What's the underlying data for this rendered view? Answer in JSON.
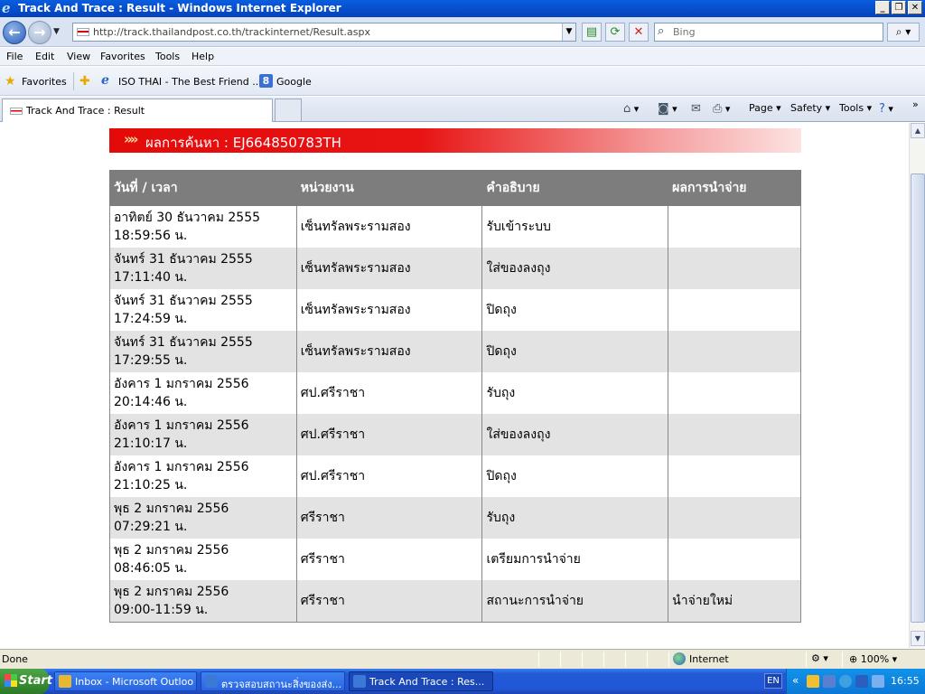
{
  "window": {
    "title": "Track And Trace : Result - Windows Internet Explorer"
  },
  "address": {
    "url": "http://track.thailandpost.co.th/trackinternet/Result.aspx"
  },
  "search": {
    "placeholder": "Bing"
  },
  "menu": [
    "File",
    "Edit",
    "View",
    "Favorites",
    "Tools",
    "Help"
  ],
  "favorites": {
    "label": "Favorites",
    "items": [
      "ISO THAI - The Best Friend ...",
      "Google"
    ]
  },
  "tab": {
    "label": "Track And Trace : Result"
  },
  "commands": {
    "page": "Page",
    "safety": "Safety",
    "tools": "Tools"
  },
  "result": {
    "label": "ผลการค้นหา : EJ664850783TH"
  },
  "table": {
    "headers": [
      "วันที่ / เวลา",
      "หน่วยงาน",
      "คำอธิบาย",
      "ผลการนำจ่าย"
    ],
    "rows": [
      {
        "date": "อาทิตย์ 30 ธันวาคม 2555",
        "time": "18:59:56 น.",
        "office": "เซ็นทรัลพระรามสอง",
        "desc": "รับเข้าระบบ",
        "result": ""
      },
      {
        "date": "จันทร์ 31 ธันวาคม 2555",
        "time": "17:11:40 น.",
        "office": "เซ็นทรัลพระรามสอง",
        "desc": "ใส่ของลงถุง",
        "result": ""
      },
      {
        "date": "จันทร์ 31 ธันวาคม 2555",
        "time": "17:24:59 น.",
        "office": "เซ็นทรัลพระรามสอง",
        "desc": "ปิดถุง",
        "result": ""
      },
      {
        "date": "จันทร์ 31 ธันวาคม 2555",
        "time": "17:29:55 น.",
        "office": "เซ็นทรัลพระรามสอง",
        "desc": "ปิดถุง",
        "result": ""
      },
      {
        "date": "อังคาร 1 มกราคม 2556",
        "time": "20:14:46 น.",
        "office": "ศป.ศรีราชา",
        "desc": "รับถุง",
        "result": ""
      },
      {
        "date": "อังคาร 1 มกราคม 2556",
        "time": "21:10:17 น.",
        "office": "ศป.ศรีราชา",
        "desc": "ใส่ของลงถุง",
        "result": ""
      },
      {
        "date": "อังคาร 1 มกราคม 2556",
        "time": "21:10:25 น.",
        "office": "ศป.ศรีราชา",
        "desc": "ปิดถุง",
        "result": ""
      },
      {
        "date": "พุธ 2 มกราคม 2556",
        "time": "07:29:21 น.",
        "office": "ศรีราชา",
        "desc": "รับถุง",
        "result": ""
      },
      {
        "date": "พุธ 2 มกราคม 2556",
        "time": "08:46:05 น.",
        "office": "ศรีราชา",
        "desc": "เตรียมการนำจ่าย",
        "result": ""
      },
      {
        "date": "พุธ 2 มกราคม 2556",
        "time": "09:00-11:59 น.",
        "office": "ศรีราชา",
        "desc": "สถานะการนำจ่าย",
        "result": "นำจ่ายใหม่"
      }
    ]
  },
  "status": {
    "text": "Done",
    "zone": "Internet",
    "zoom": "100%"
  },
  "taskbar": {
    "start": "Start",
    "items": [
      "Inbox - Microsoft Outlook",
      "ตรวจสอบสถานะสิ่งของส่ง...",
      "Track And Trace : Res..."
    ],
    "lang": "EN",
    "clock": "16:55"
  },
  "colors": {
    "result_bar": "#e40a0a",
    "header_bg": "#7d7d7d",
    "alt_row": "#e3e3e3",
    "titlebar": "#0a5de0"
  }
}
